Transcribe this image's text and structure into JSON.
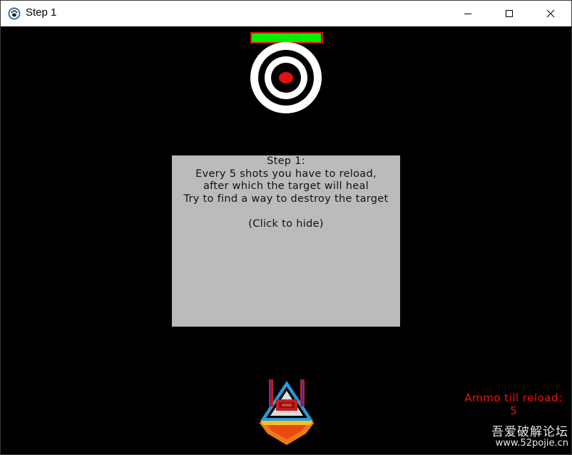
{
  "window": {
    "title": "Step 1",
    "icon": "paw-icon",
    "controls": [
      "minimize-icon",
      "maximize-icon",
      "close-icon"
    ]
  },
  "game": {
    "target_health_fraction": 0.99,
    "colors": {
      "background": "#000000",
      "health_fill": "#00ee00",
      "health_border": "#e01010",
      "target_center": "#e01010",
      "panel": "#bbbbbb",
      "ammo_text": "#ee1111"
    },
    "info_panel": {
      "lines": [
        "Step 1:",
        "Every 5 shots you have to reload,",
        "after which the target will heal",
        "Try to find a way to destroy the target",
        "",
        "(Click to hide)"
      ]
    },
    "ammo": {
      "label": "Ammo till reload:",
      "value": "5"
    }
  },
  "watermark": {
    "main": "吾爱破解论坛",
    "sub": "www.52pojie.cn"
  }
}
